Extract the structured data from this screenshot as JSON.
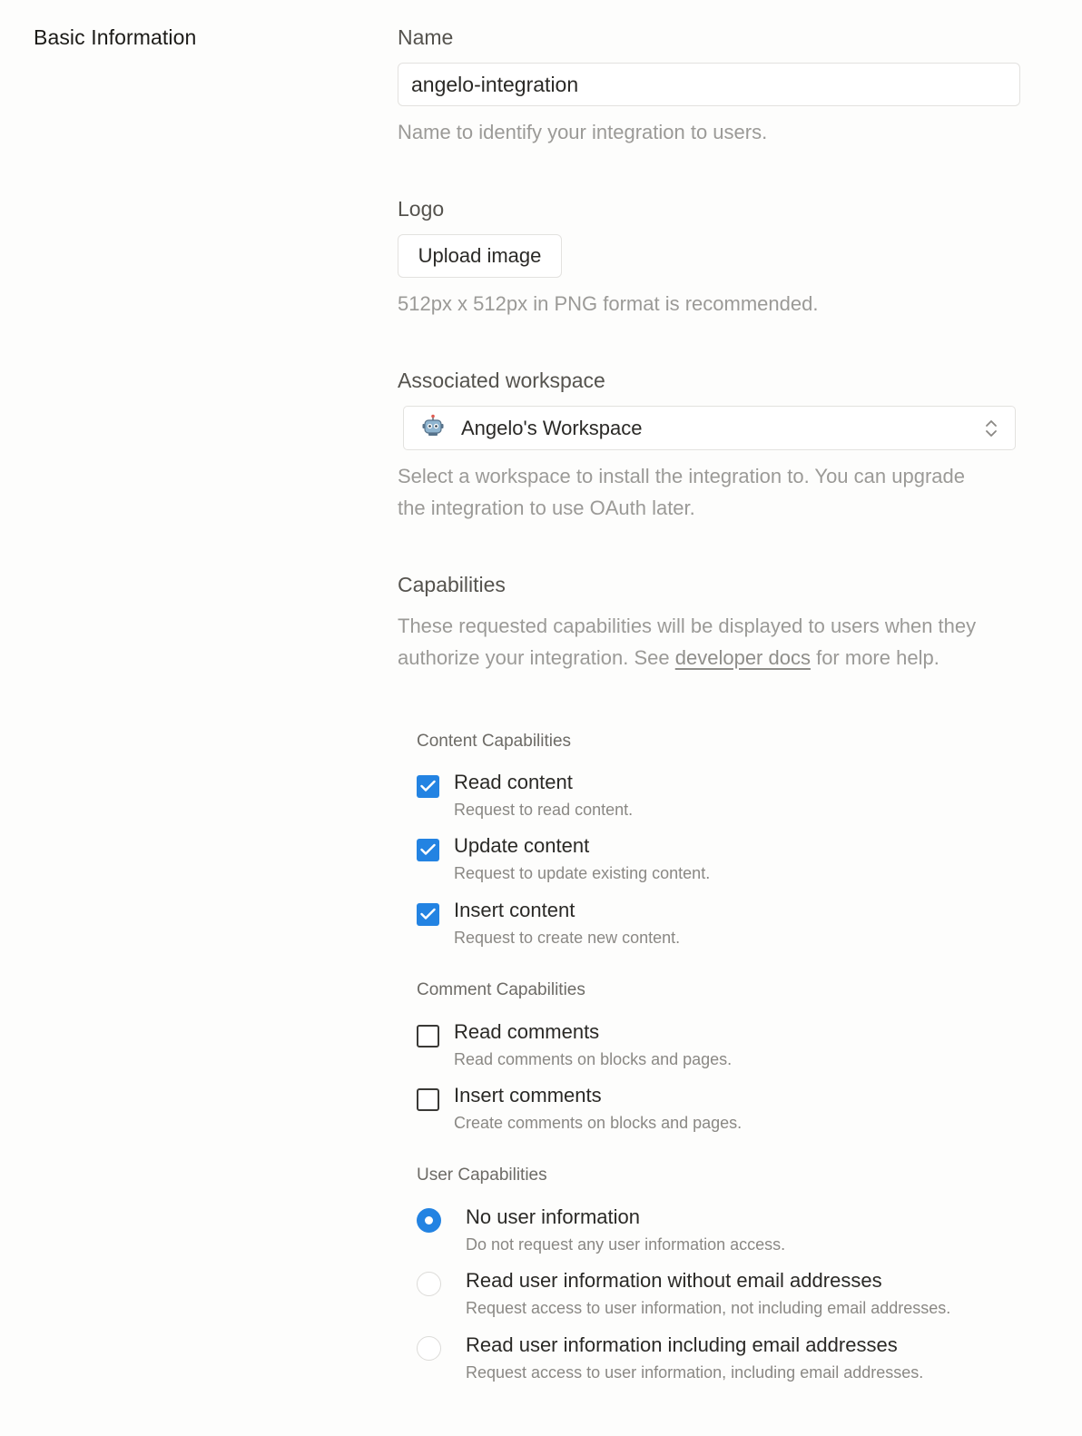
{
  "section": {
    "title": "Basic Information"
  },
  "name_field": {
    "label": "Name",
    "value": "angelo-integration",
    "help": "Name to identify your integration to users."
  },
  "logo": {
    "label": "Logo",
    "button_label": "Upload image",
    "help": "512px x 512px in PNG format is recommended."
  },
  "workspace": {
    "label": "Associated workspace",
    "selected": "Angelo's Workspace",
    "icon": "robot-icon",
    "help": "Select a workspace to install the integration to. You can upgrade the integration to use OAuth later."
  },
  "capabilities": {
    "label": "Capabilities",
    "help_before": "These requested capabilities will be displayed to users when they authorize your integration. See ",
    "help_link": "developer docs",
    "help_after": " for more help.",
    "groups": [
      {
        "title": "Content Capabilities",
        "items": [
          {
            "label": "Read content",
            "description": "Request to read content.",
            "checked": true
          },
          {
            "label": "Update content",
            "description": "Request to update existing content.",
            "checked": true
          },
          {
            "label": "Insert content",
            "description": "Request to create new content.",
            "checked": true
          }
        ]
      },
      {
        "title": "Comment Capabilities",
        "items": [
          {
            "label": "Read comments",
            "description": "Read comments on blocks and pages.",
            "checked": false
          },
          {
            "label": "Insert comments",
            "description": "Create comments on blocks and pages.",
            "checked": false
          }
        ]
      },
      {
        "title": "User Capabilities",
        "items": [
          {
            "label": "No user information",
            "description": "Do not request any user information access.",
            "selected": true
          },
          {
            "label": "Read user information without email addresses",
            "description": "Request access to user information, not including email addresses.",
            "selected": false
          },
          {
            "label": "Read user information including email addresses",
            "description": "Request access to user information, including email addresses.",
            "selected": false
          }
        ]
      }
    ]
  },
  "colors": {
    "accent": "#2383e2",
    "muted_text": "#9b9a97",
    "border": "#e3e2df"
  }
}
